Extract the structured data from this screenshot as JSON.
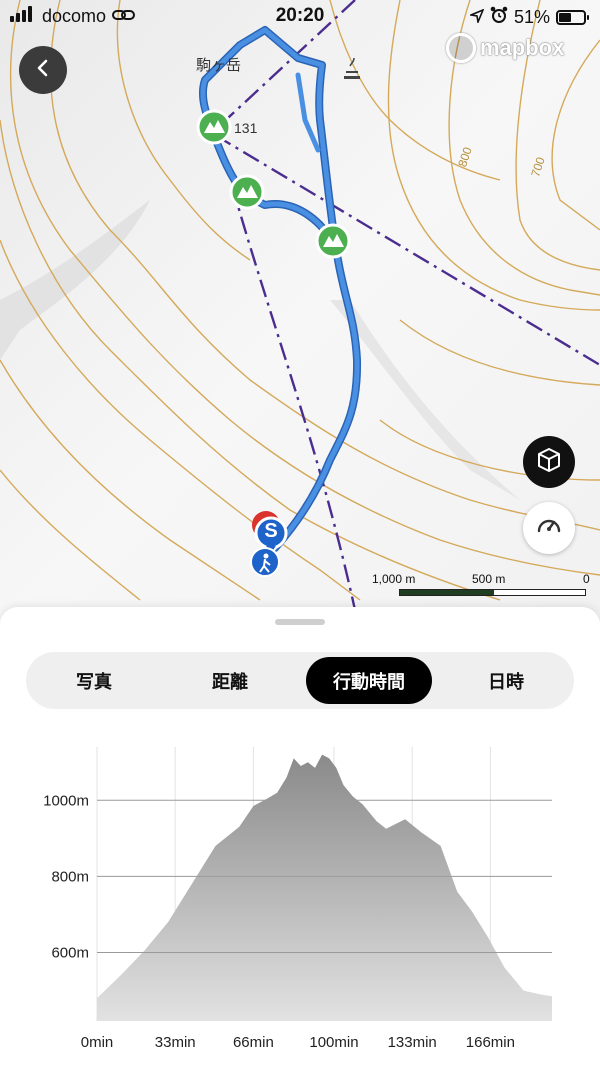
{
  "status_bar": {
    "carrier": "docomo",
    "time": "20:20",
    "battery": "51%",
    "battery_level": 0.51
  },
  "map": {
    "provider": "mapbox",
    "peak_label": "駒ヶ岳",
    "spot_elevation": "131",
    "contour_labels": [
      "800",
      "700"
    ],
    "scale": {
      "labels": [
        "1,000 m",
        "500 m",
        "0"
      ]
    },
    "colors": {
      "route": "#4a90e2",
      "peak_marker": "#4caf50",
      "boundary": "#4b2c8f",
      "contour": "#d4a95a",
      "start_marker": "#1e63c9"
    }
  },
  "tabs": {
    "items": [
      "写真",
      "距離",
      "行動時間",
      "日時"
    ],
    "active": "行動時間"
  },
  "chart_data": {
    "type": "area",
    "xlabel": "",
    "ylabel": "",
    "x_ticks": [
      "0min",
      "33min",
      "66min",
      "100min",
      "133min",
      "166min"
    ],
    "y_ticks": [
      "600m",
      "800m",
      "1000m"
    ],
    "xlim": [
      0,
      192
    ],
    "ylim": [
      420,
      1140
    ],
    "grid": true,
    "series": [
      {
        "x": [
          0,
          10,
          20,
          30,
          40,
          50,
          60,
          66,
          72,
          76,
          80,
          83,
          86,
          89,
          92,
          95,
          98,
          101,
          104,
          108,
          112,
          118,
          122,
          130,
          137,
          145,
          152,
          158,
          165,
          172,
          180,
          187,
          192
        ],
        "y": [
          480,
          540,
          605,
          680,
          780,
          880,
          930,
          985,
          1005,
          1020,
          1060,
          1110,
          1090,
          1100,
          1085,
          1120,
          1110,
          1085,
          1040,
          1010,
          990,
          945,
          925,
          950,
          915,
          880,
          760,
          710,
          640,
          560,
          500,
          490,
          485
        ]
      }
    ]
  }
}
